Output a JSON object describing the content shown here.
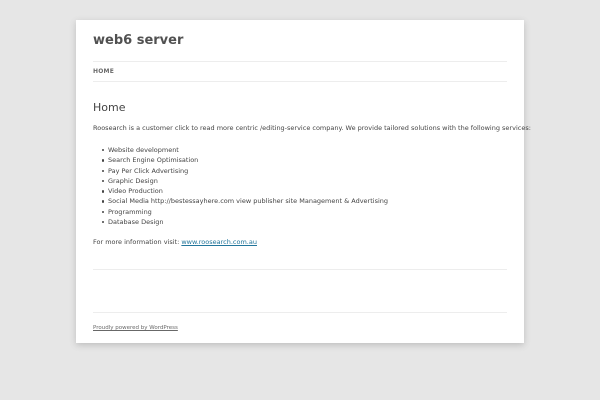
{
  "site": {
    "title": "web6 server"
  },
  "nav": {
    "home_label": "HOME"
  },
  "entry": {
    "title": "Home",
    "intro": "Roosearch is a customer click to read more centric /editing-service company. We provide tailored solutions with the following services:",
    "services": [
      "Website development",
      "Search Engine Optimisation",
      "Pay Per Click Advertising",
      "Graphic Design",
      "Video Production",
      "Social Media http://bestessayhere.com view publisher site Management & Advertising",
      "Programming",
      "Database Design"
    ],
    "more_info_prefix": "For more information visit: ",
    "more_info_link": "www.roosearch.com.au"
  },
  "footer": {
    "powered_by": "Proudly powered by WordPress"
  },
  "colors": {
    "background": "#e6e6e6",
    "page": "#ffffff",
    "link": "#21759b",
    "text": "#444444"
  }
}
